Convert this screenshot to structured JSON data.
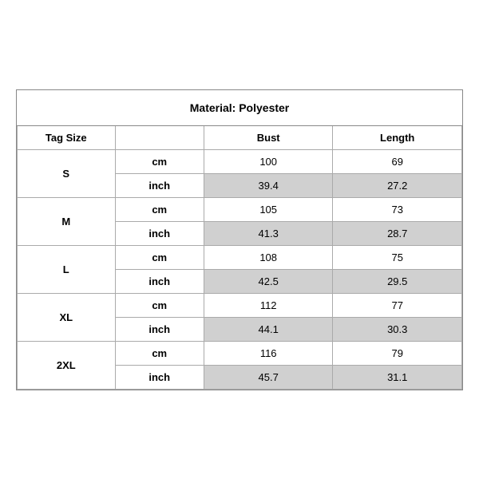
{
  "title": "Material: Polyester",
  "headers": {
    "tag_size": "Tag Size",
    "bust": "Bust",
    "length": "Length"
  },
  "sizes": [
    {
      "label": "S",
      "cm": {
        "bust": "100",
        "length": "69"
      },
      "inch": {
        "bust": "39.4",
        "length": "27.2"
      }
    },
    {
      "label": "M",
      "cm": {
        "bust": "105",
        "length": "73"
      },
      "inch": {
        "bust": "41.3",
        "length": "28.7"
      }
    },
    {
      "label": "L",
      "cm": {
        "bust": "108",
        "length": "75"
      },
      "inch": {
        "bust": "42.5",
        "length": "29.5"
      }
    },
    {
      "label": "XL",
      "cm": {
        "bust": "112",
        "length": "77"
      },
      "inch": {
        "bust": "44.1",
        "length": "30.3"
      }
    },
    {
      "label": "2XL",
      "cm": {
        "bust": "116",
        "length": "79"
      },
      "inch": {
        "bust": "45.7",
        "length": "31.1"
      }
    }
  ],
  "units": {
    "cm": "cm",
    "inch": "inch"
  }
}
